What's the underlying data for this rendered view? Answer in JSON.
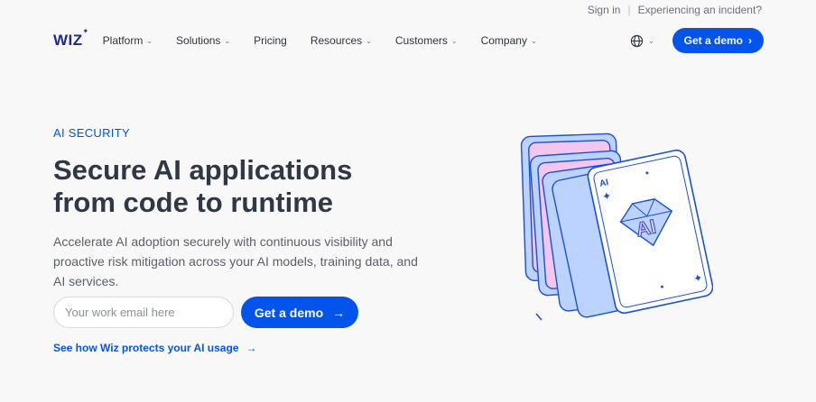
{
  "topbar": {
    "signin": "Sign in",
    "incident": "Experiencing an incident?"
  },
  "nav": {
    "logo": "WIZ",
    "items": [
      {
        "label": "Platform",
        "has_chevron": true
      },
      {
        "label": "Solutions",
        "has_chevron": true
      },
      {
        "label": "Pricing",
        "has_chevron": false
      },
      {
        "label": "Resources",
        "has_chevron": true
      },
      {
        "label": "Customers",
        "has_chevron": true
      },
      {
        "label": "Company",
        "has_chevron": true
      }
    ],
    "cta": "Get a demo"
  },
  "hero": {
    "eyebrow": "AI SECURITY",
    "headline": "Secure AI applications from code to runtime",
    "description": "Accelerate AI adoption securely with continuous visibility and proactive risk mitigation across your AI models, training data, and AI services.",
    "email_placeholder": "Your work email here",
    "cta": "Get a demo",
    "link": "See how Wiz protects your AI usage"
  },
  "art": {
    "card_text": "AI",
    "corner_text": "AI"
  },
  "colors": {
    "accent": "#0254ec",
    "card_pink": "#f3c6ef",
    "card_blue": "#bcd3ff"
  }
}
